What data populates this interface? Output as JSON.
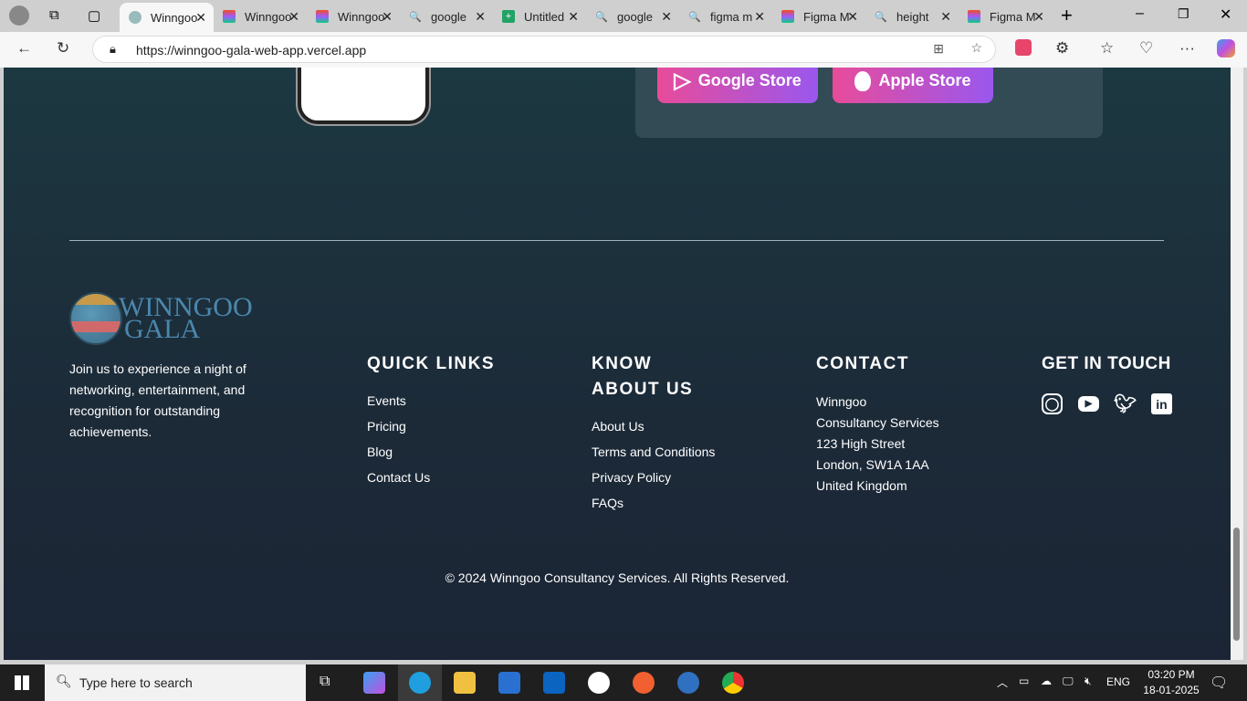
{
  "browser": {
    "tabs": [
      {
        "label": "Winngoo",
        "icon": "winngoo-favicon",
        "active": true
      },
      {
        "label": "Winngoo",
        "icon": "figma-icon"
      },
      {
        "label": "Winngoo",
        "icon": "figma-icon"
      },
      {
        "label": "google",
        "icon": "search-icon"
      },
      {
        "label": "Untitled",
        "icon": "sheets-icon"
      },
      {
        "label": "google",
        "icon": "search-icon"
      },
      {
        "label": "figma m",
        "icon": "search-icon"
      },
      {
        "label": "Figma M",
        "icon": "figma-icon"
      },
      {
        "label": "height",
        "icon": "search-icon"
      },
      {
        "label": "Figma M",
        "icon": "figma-icon"
      }
    ],
    "url": "https://winngoo-gala-web-app.vercel.app"
  },
  "hero": {
    "google_store": "Google Store",
    "apple_store": "Apple Store"
  },
  "footer": {
    "logo_line1": "WINNGOO",
    "logo_line2": "GALA",
    "description": "Join us to experience a night of networking, entertainment, and recognition for outstanding achievements.",
    "quick_links": {
      "title": "QUICK LINKS",
      "items": [
        "Events",
        "Pricing",
        "Blog",
        "Contact Us"
      ]
    },
    "know_about": {
      "title_line1": "KNOW",
      "title_line2": "ABOUT US",
      "items": [
        "About Us",
        "Terms and Conditions",
        "Privacy Policy",
        "FAQs"
      ]
    },
    "contact": {
      "title": "CONTACT",
      "lines": [
        "Winngoo",
        "Consultancy Services",
        "123 High Street",
        "London, SW1A 1AA",
        "United Kingdom"
      ]
    },
    "get_in_touch": {
      "title": "GET IN TOUCH",
      "icons": [
        "instagram-icon",
        "youtube-icon",
        "twitter-icon",
        "linkedin-icon"
      ]
    },
    "copyright": "© 2024 Winngoo Consultancy Services. All Rights Reserved."
  },
  "taskbar": {
    "search_placeholder": "Type here to search",
    "language": "ENG",
    "time": "03:20 PM",
    "date": "18-01-2025"
  },
  "colors": {
    "button_gradient_start": "#e84c9a",
    "button_gradient_end": "#9a57ee",
    "footer_bg": "#1c2a38"
  }
}
